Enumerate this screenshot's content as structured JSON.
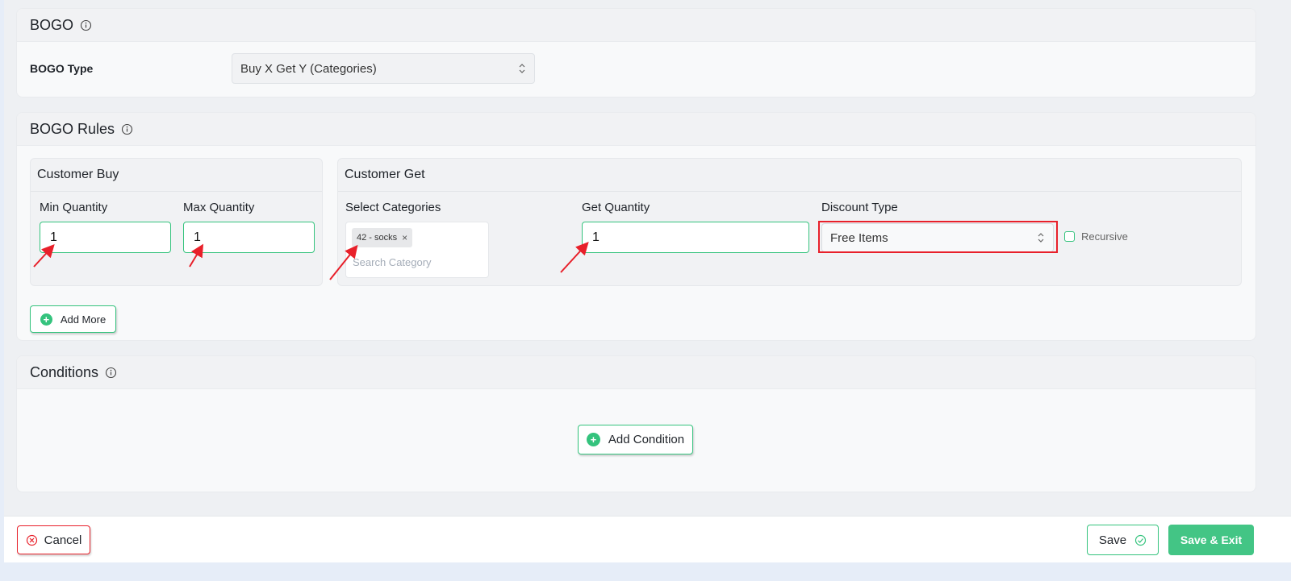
{
  "bogo_section": {
    "title": "BOGO",
    "type_label": "BOGO Type",
    "type_value": "Buy X Get Y (Categories)"
  },
  "rules_section": {
    "title": "BOGO Rules",
    "customer_buy": {
      "title": "Customer Buy",
      "min_label": "Min Quantity",
      "min_value": "1",
      "max_label": "Max Quantity",
      "max_value": "1"
    },
    "customer_get": {
      "title": "Customer Get",
      "categories_label": "Select Categories",
      "category_tag": "42 - socks",
      "category_placeholder": "Search Category",
      "get_qty_label": "Get Quantity",
      "get_qty_value": "1",
      "discount_label": "Discount Type",
      "discount_value": "Free Items",
      "recursive_label": "Recursive"
    },
    "add_more": "Add More"
  },
  "conditions_section": {
    "title": "Conditions",
    "add_condition": "Add Condition"
  },
  "footer": {
    "cancel": "Cancel",
    "save": "Save",
    "save_exit": "Save & Exit"
  },
  "colors": {
    "accent_green": "#34c37d",
    "annotation_red": "#e8202a"
  }
}
